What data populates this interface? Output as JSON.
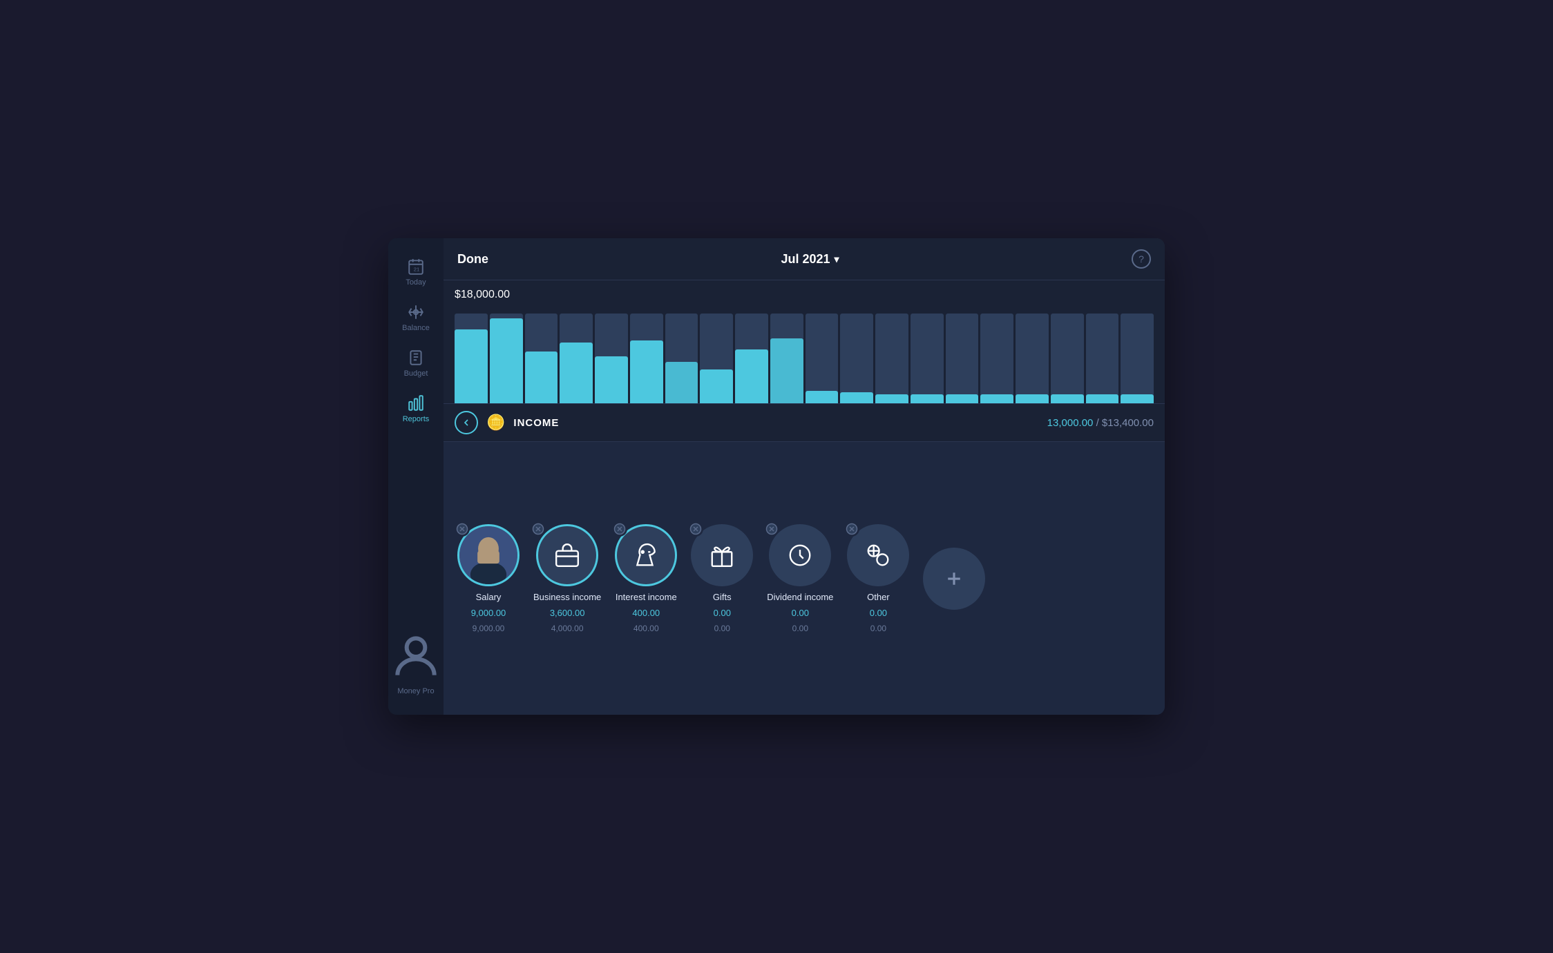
{
  "header": {
    "done_label": "Done",
    "title": "Jul 2021",
    "chevron": "▾",
    "help": "?"
  },
  "chart": {
    "y_label": "$18,000.00",
    "bars": [
      {
        "fill": 85,
        "bg": 100
      },
      {
        "fill": 95,
        "bg": 100
      },
      {
        "fill": 60,
        "bg": 100
      },
      {
        "fill": 70,
        "bg": 100
      },
      {
        "fill": 55,
        "bg": 100
      },
      {
        "fill": 72,
        "bg": 100
      },
      {
        "fill": 48,
        "bg": 100
      },
      {
        "fill": 40,
        "bg": 100
      },
      {
        "fill": 62,
        "bg": 100
      },
      {
        "fill": 75,
        "bg": 100
      },
      {
        "fill": 15,
        "bg": 100
      },
      {
        "fill": 12,
        "bg": 100
      },
      {
        "fill": 10,
        "bg": 100
      },
      {
        "fill": 10,
        "bg": 100
      },
      {
        "fill": 10,
        "bg": 100
      },
      {
        "fill": 10,
        "bg": 100
      },
      {
        "fill": 10,
        "bg": 100
      },
      {
        "fill": 10,
        "bg": 100
      },
      {
        "fill": 10,
        "bg": 100
      },
      {
        "fill": 10,
        "bg": 100
      }
    ]
  },
  "income_section": {
    "label": "INCOME",
    "current": "13,000.00",
    "separator": " / ",
    "budget": "$13,400.00"
  },
  "categories": [
    {
      "id": "salary",
      "name": "Salary",
      "value": "9,000.00",
      "budget": "9,000.00",
      "has_photo": true,
      "removable": true,
      "active_border": true
    },
    {
      "id": "business-income",
      "name": "Business income",
      "value": "3,600.00",
      "budget": "4,000.00",
      "has_photo": false,
      "removable": true,
      "active_border": true,
      "icon": "briefcase"
    },
    {
      "id": "interest-income",
      "name": "Interest income",
      "value": "400.00",
      "budget": "400.00",
      "has_photo": false,
      "removable": true,
      "active_border": true,
      "icon": "piggy"
    },
    {
      "id": "gifts",
      "name": "Gifts",
      "value": "0.00",
      "budget": "0.00",
      "has_photo": false,
      "removable": true,
      "active_border": false,
      "icon": "gift"
    },
    {
      "id": "dividend-income",
      "name": "Dividend income",
      "value": "0.00",
      "budget": "0.00",
      "has_photo": false,
      "removable": true,
      "active_border": false,
      "icon": "clock"
    },
    {
      "id": "other",
      "name": "Other",
      "value": "0.00",
      "budget": "0.00",
      "has_photo": false,
      "removable": true,
      "active_border": false,
      "icon": "coins"
    }
  ],
  "sidebar": {
    "items": [
      {
        "id": "today",
        "label": "Today",
        "icon": "calendar"
      },
      {
        "id": "balance",
        "label": "Balance",
        "icon": "balance"
      },
      {
        "id": "budget",
        "label": "Budget",
        "icon": "budget"
      },
      {
        "id": "reports",
        "label": "Reports",
        "icon": "reports",
        "active": true
      }
    ],
    "bottom": {
      "label": "Money Pro",
      "icon": "person"
    }
  },
  "add_button": {
    "label": "+"
  }
}
